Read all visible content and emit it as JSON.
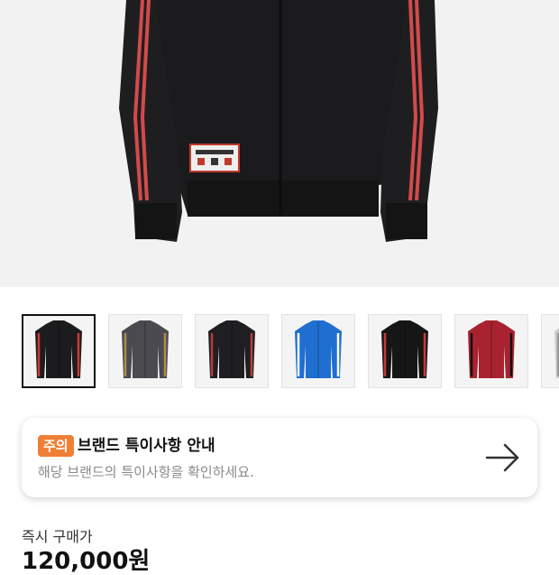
{
  "product": {
    "hero_image": "black-track-jacket-red-stripes",
    "thumbnails": [
      {
        "name": "thumb-black-red-jacket",
        "body": "#1c1c1e",
        "stripe": "#c93a3a",
        "selected": true
      },
      {
        "name": "thumb-grey-gold-jacket",
        "body": "#4a4a50",
        "stripe": "#b08a4a",
        "selected": false
      },
      {
        "name": "thumb-black-red-jacket-alt",
        "body": "#1f1f22",
        "stripe": "#b83b3b",
        "selected": false
      },
      {
        "name": "thumb-blue-jacket",
        "body": "#1f6fd1",
        "stripe": "#ffffff",
        "selected": false
      },
      {
        "name": "thumb-black-red-sleeve-jacket",
        "body": "#161616",
        "stripe": "#c8383b",
        "selected": false
      },
      {
        "name": "thumb-red-pattern-jacket",
        "body": "#a8232f",
        "stripe": "#111111",
        "selected": false
      },
      {
        "name": "thumb-partial",
        "body": "#cccccc",
        "stripe": "#999999",
        "selected": false
      }
    ]
  },
  "notice": {
    "badge": "주의",
    "title": "브랜드 특이사항 안내",
    "description": "해당 브랜드의 특이사항을 확인하세요.",
    "arrow_icon": "arrow-right-icon",
    "badge_color": "#f07f36"
  },
  "price": {
    "label": "즉시 구매가",
    "value": "120,000원"
  }
}
